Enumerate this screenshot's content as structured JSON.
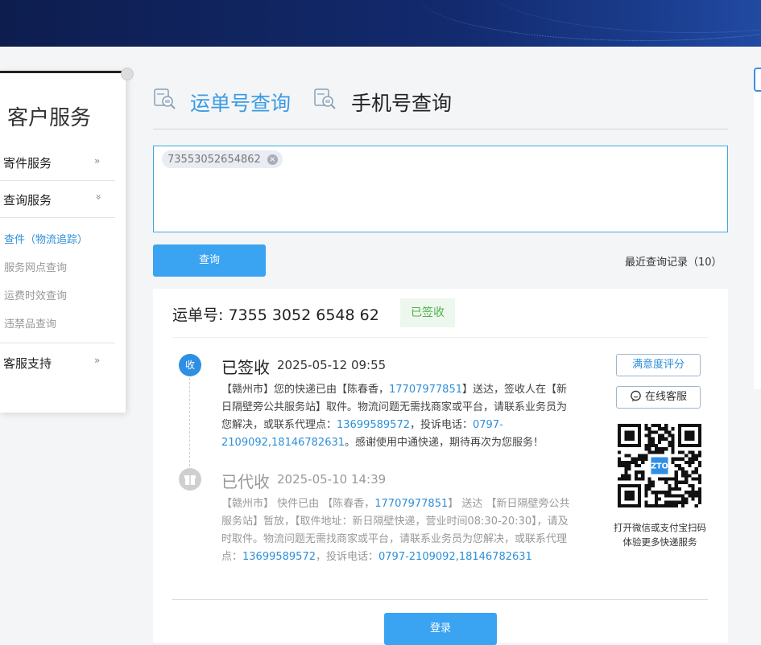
{
  "sidebar": {
    "title": "客户服务",
    "items": [
      {
        "label": "寄件服务",
        "arrow": "»"
      },
      {
        "label": "查询服务",
        "arrow": "»"
      },
      {
        "label": "客服支持",
        "arrow": "»"
      }
    ],
    "subitems": [
      {
        "label": "查件（物流追踪）",
        "active": true
      },
      {
        "label": "服务网点查询",
        "active": false
      },
      {
        "label": "运费时效查询",
        "active": false
      },
      {
        "label": "违禁品查询",
        "active": false
      }
    ]
  },
  "tabs": [
    {
      "label": "运单号查询",
      "active": true
    },
    {
      "label": "手机号查询",
      "active": false
    }
  ],
  "query": {
    "chip": "73553052654862",
    "chip_remove": "×",
    "button": "查询",
    "recent": "最近查询记录（10）"
  },
  "result": {
    "waybill": "运单号: 7355 3052 6548 62",
    "status_badge": "已签收",
    "events": [
      {
        "icon_label": "收",
        "title": "已签收",
        "time": "2025-05-12 09:55",
        "parts": [
          {
            "t": "【赣州市】您的快递已由【陈春香，",
            "hl": false
          },
          {
            "t": "17707977851",
            "hl": true
          },
          {
            "t": "】送达，签收人在【新日隔壁旁公共服务站】取件。物流问题无需找商家或平台，请联系业务员为您解决，或联系代理点：",
            "hl": false
          },
          {
            "t": "13699589572",
            "hl": true
          },
          {
            "t": "，投诉电话：",
            "hl": false
          },
          {
            "t": "0797-2109092,18146782631",
            "hl": true
          },
          {
            "t": "。感谢使用中通快递，期待再次为您服务！",
            "hl": false
          }
        ]
      },
      {
        "title": "已代收",
        "time": "2025-05-10 14:39",
        "parts": [
          {
            "t": "【赣州市】 快件已由 【陈春香，",
            "hl": false
          },
          {
            "t": "17707977851",
            "hl": true
          },
          {
            "t": "】 送达 【新日隔壁旁公共服务站】暂放，【取件地址：新日隔壁快递，营业时间08:30-20:30】，请及时取件。物流问题无需找商家或平台，请联系业务员为您解决，或联系代理点：",
            "hl": false
          },
          {
            "t": "13699589572",
            "hl": true
          },
          {
            "t": "，投诉电话：",
            "hl": false
          },
          {
            "t": "0797-2109092,18146782631",
            "hl": true
          }
        ]
      }
    ],
    "rate_button": "满意度评分",
    "chat_button": "在线客服",
    "qr_caption_1": "打开微信或支付宝扫码",
    "qr_caption_2": "体验更多快递服务",
    "qr_logo": "ZTO",
    "login_button": "登录"
  }
}
